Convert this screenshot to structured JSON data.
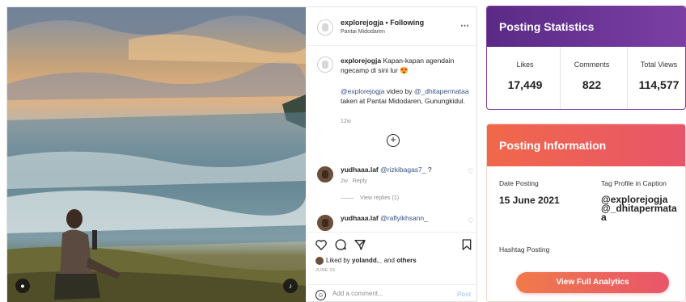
{
  "post": {
    "photo_alt": "",
    "username": "explorejogja",
    "following_label": "Following",
    "location": "Pantai Midodaren",
    "more_icon": "more-horizontal-icon",
    "caption": {
      "username": "explorejogja",
      "text": "Kapan-kapan agendain ngecamp di sini lur",
      "emoji": "😍",
      "credit_user": "@explorejogja",
      "credit_text_1": "video by",
      "credit_user_2": "@_dhitapermataa",
      "credit_text_2": "taken at Pantai Midodaren, Gunungkidul.",
      "time": "12w"
    },
    "comments": [
      {
        "username": "yudhaaa.laf",
        "mention": "@rizkibagas7_",
        "text": "?",
        "time": "2w",
        "reply_label": "Reply"
      },
      {
        "username": "yudhaaa.laf",
        "mention": "@raflyikhsann_",
        "text": ""
      }
    ],
    "view_replies": "View replies (1)",
    "liked_by_prefix": "Liked by",
    "liked_by_user": "yolandd._",
    "liked_by_and": "and",
    "liked_by_others": "others",
    "date": "JUNE 15",
    "add_comment_placeholder": "Add a comment...",
    "post_button": "Post"
  },
  "stats": {
    "title": "Posting Statistics",
    "items": [
      {
        "label": "Likes",
        "value": "17,449"
      },
      {
        "label": "Comments",
        "value": "822"
      },
      {
        "label": "Total Views",
        "value": "114,577"
      }
    ]
  },
  "info": {
    "title": "Posting Information",
    "date_label": "Date Posting",
    "date_value": "15 June 2021",
    "tag_label": "Tag Profile in Caption",
    "tag_value_1": "@explorejogja",
    "tag_value_2": "@_dhitapermataa",
    "hashtag_label": "Hashtag Posting",
    "cta": "View Full Analytics"
  },
  "colors": {
    "stats_header": "#6a3196",
    "info_header": "#ee6150",
    "link": "#385185"
  }
}
